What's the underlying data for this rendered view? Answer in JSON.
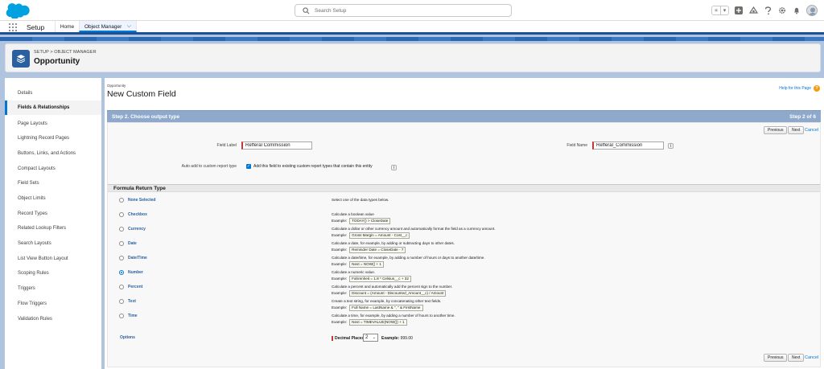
{
  "header": {
    "search_placeholder": "Search Setup"
  },
  "context_bar": {
    "app_name": "Setup",
    "tabs": [
      {
        "label": "Home"
      },
      {
        "label": "Object Manager"
      }
    ]
  },
  "page_header": {
    "breadcrumb": "SETUP > OBJECT MANAGER",
    "title": "Opportunity"
  },
  "sidebar": {
    "items": [
      {
        "label": "Details"
      },
      {
        "label": "Fields & Relationships",
        "active": true
      },
      {
        "label": "Page Layouts"
      },
      {
        "label": "Lightning Record Pages"
      },
      {
        "label": "Buttons, Links, and Actions"
      },
      {
        "label": "Compact Layouts"
      },
      {
        "label": "Field Sets"
      },
      {
        "label": "Object Limits"
      },
      {
        "label": "Record Types"
      },
      {
        "label": "Related Lookup Filters"
      },
      {
        "label": "Search Layouts"
      },
      {
        "label": "List View Button Layout"
      },
      {
        "label": "Scoping Rules"
      },
      {
        "label": "Triggers"
      },
      {
        "label": "Flow Triggers"
      },
      {
        "label": "Validation Rules"
      }
    ]
  },
  "main": {
    "breadcrumb": "Opportunity",
    "title": "New Custom Field",
    "help_link": "Help for this Page",
    "help_icon": "?",
    "step_title": "Step 2. Choose output type",
    "step_counter": "Step 2 of 6",
    "buttons": {
      "previous": "Previous",
      "next": "Next",
      "cancel": "Cancel"
    },
    "field_label_label": "Field Label",
    "field_label_value": "Refferal Commission",
    "field_name_label": "Field Name",
    "field_name_value": "Refferal_Commission",
    "info_icon": "i",
    "auto_add_label": "Auto add to custom report type",
    "auto_add_text": "Add this field to existing custom report types that contain this entity",
    "auto_add_checked": true,
    "section_title": "Formula Return Type",
    "types": [
      {
        "label": "None Selected",
        "desc": "Select one of the data types below.",
        "example": ""
      },
      {
        "label": "Checkbox",
        "desc": "Calculate a boolean value",
        "example": "TODAY() > CloseDate"
      },
      {
        "label": "Currency",
        "desc": "Calculate a dollar or other currency amount and automatically format the field as a currency amount.",
        "example": "Gross Margin = Amount - Cost__c"
      },
      {
        "label": "Date",
        "desc": "Calculate a date, for example, by adding or subtracting days to other dates.",
        "example": "Reminder Date = CloseDate - 7"
      },
      {
        "label": "Date/Time",
        "desc": "Calculate a date/time, for example, by adding a number of hours or days to another date/time.",
        "example": "Next = NOW() + 1"
      },
      {
        "label": "Number",
        "desc": "Calculate a numeric value.",
        "example": "Fahrenheit = 1.8 * Celsius__c + 32",
        "selected": true
      },
      {
        "label": "Percent",
        "desc": "Calculate a percent and automatically add the percent sign to the number.",
        "example": "Discount = (Amount - Discounted_Amount__c) / Amount"
      },
      {
        "label": "Text",
        "desc": "Create a text string, for example, by concatenating other text fields.",
        "example": "Full Name = LastName & \", \" & FirstName"
      },
      {
        "label": "Time",
        "desc": "Calculate a time, for example, by adding a number of hours to another time.",
        "example": "Next = TIMEVALUE(NOW()) + 1"
      }
    ],
    "example_prefix": "Example:",
    "options_label": "Options",
    "decimal_places_label": "Decimal Places",
    "decimal_places_value": "2",
    "decimal_example_label": "Example:",
    "decimal_example_value": "999.00"
  }
}
